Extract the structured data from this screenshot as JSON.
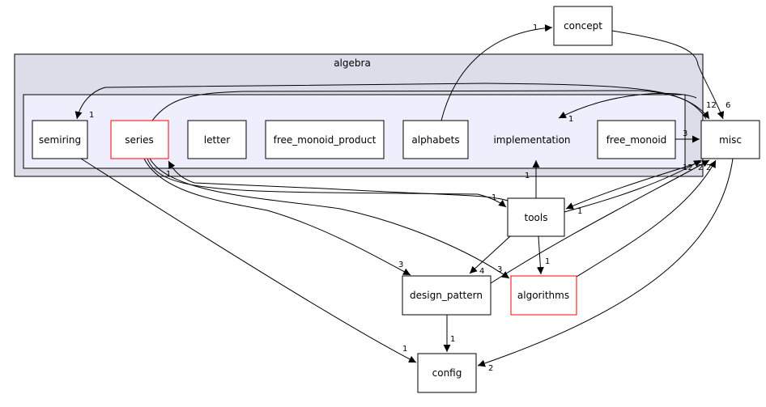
{
  "clusters": {
    "outer": "algebra"
  },
  "nodes": {
    "concept": "concept",
    "semiring": "semiring",
    "series": "series",
    "letter": "letter",
    "free_monoid_product": "free_monoid_product",
    "alphabets": "alphabets",
    "implementation": "implementation",
    "free_monoid": "free_monoid",
    "misc": "misc",
    "tools": "tools",
    "design_pattern": "design_pattern",
    "algorithms": "algorithms",
    "config": "config"
  },
  "colors": {
    "outer_cluster": "#dddde9",
    "inner_cluster": "#eeeefc",
    "highlight_border": "#ff0000"
  },
  "edges": {
    "alphabets_concept": "1",
    "concept_misc": "6",
    "series_misc": "12",
    "misc_semiring": "1",
    "misc_implementation": "1",
    "free_monoid_misc": "3",
    "tools_implementation": "1",
    "series_tools": "1",
    "tools_series": "1",
    "misc_tools": "1",
    "tools_misc": "12",
    "design_pattern_misc": "2",
    "algorithms_misc": "2",
    "series_design_pattern": "3",
    "tools_design_pattern": "4",
    "series_algorithms": "3",
    "tools_algorithms": "1",
    "design_pattern_config": "1",
    "semiring_config": "1",
    "misc_config": "2"
  }
}
